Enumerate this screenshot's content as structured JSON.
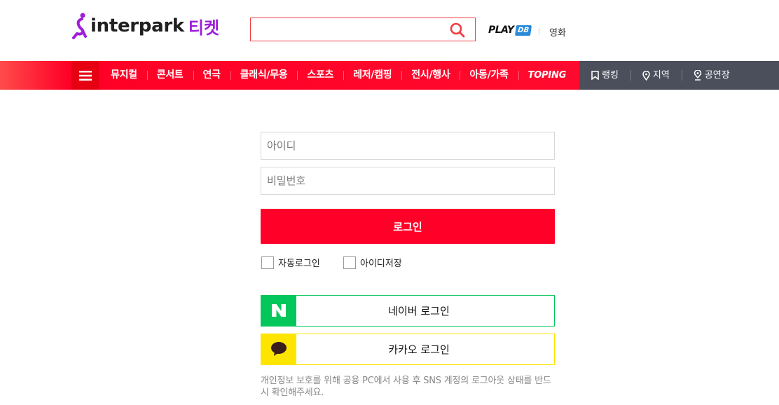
{
  "header": {
    "logo_word": "interpark",
    "logo_ticket": "티켓",
    "search_placeholder": "",
    "playdb_text": "PLAY",
    "playdb_box": "DB",
    "movie_link": "영화"
  },
  "nav": {
    "items": [
      "뮤지컬",
      "콘서트",
      "연극",
      "클래식/무용",
      "스포츠",
      "레저/캠핑",
      "전시/행사",
      "아동/가족",
      "TOPING"
    ],
    "right": [
      "랭킹",
      "지역",
      "공연장"
    ]
  },
  "login": {
    "id_placeholder": "아이디",
    "pw_placeholder": "비밀번호",
    "login_button": "로그인",
    "auto_login": "자동로그인",
    "save_id": "아이디저장",
    "naver_login": "네이버 로그인",
    "kakao_login": "카카오 로그인",
    "notice": "개인정보 보호를 위해 공용 PC에서 사용 후 SNS 계정의 로그아웃 상태를 반드시 확인해주세요."
  },
  "colors": {
    "brand_red": "#ff0028",
    "nav_dark": "#4b4f5c",
    "naver_green": "#03c75a",
    "kakao_yellow": "#fee500",
    "ticket_purple": "#9e1fd8"
  }
}
